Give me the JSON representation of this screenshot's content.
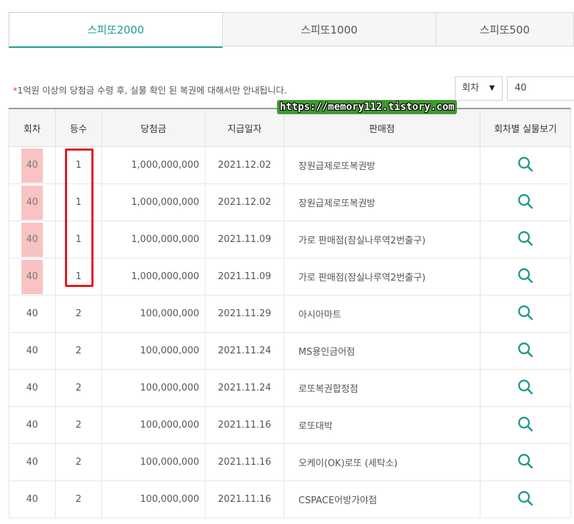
{
  "tabs": [
    {
      "label": "스피또2000",
      "active": true
    },
    {
      "label": "스피또1000",
      "active": false
    },
    {
      "label": "스피또500",
      "active": false
    }
  ],
  "notice": {
    "star": "*",
    "text": "1억원 이상의 당첨금 수령 후, 실물 확인 된 복권에 대해서만 안내됩니다."
  },
  "search": {
    "select_label": "회차",
    "round_value": "40"
  },
  "watermark": "https://memory112.tistory.com",
  "table": {
    "headers": [
      "회차",
      "등수",
      "당첨금",
      "지급일자",
      "판매점",
      "회차별 실물보기"
    ],
    "rows": [
      {
        "round": "40",
        "rank": "1",
        "prize": "1,000,000,000",
        "date": "2021.12.02",
        "store": "장원급제로또복권방",
        "highlight": true
      },
      {
        "round": "40",
        "rank": "1",
        "prize": "1,000,000,000",
        "date": "2021.12.02",
        "store": "장원급제로또복권방",
        "highlight": true
      },
      {
        "round": "40",
        "rank": "1",
        "prize": "1,000,000,000",
        "date": "2021.11.09",
        "store": "가로 판매점(잠실나루역2번출구)",
        "highlight": true
      },
      {
        "round": "40",
        "rank": "1",
        "prize": "1,000,000,000",
        "date": "2021.11.09",
        "store": "가로 판매점(잠실나루역2번출구)",
        "highlight": true
      },
      {
        "round": "40",
        "rank": "2",
        "prize": "100,000,000",
        "date": "2021.11.29",
        "store": "아시아마트",
        "highlight": false
      },
      {
        "round": "40",
        "rank": "2",
        "prize": "100,000,000",
        "date": "2021.11.24",
        "store": "MS용인금어점",
        "highlight": false
      },
      {
        "round": "40",
        "rank": "2",
        "prize": "100,000,000",
        "date": "2021.11.24",
        "store": "로또복권합정점",
        "highlight": false
      },
      {
        "round": "40",
        "rank": "2",
        "prize": "100,000,000",
        "date": "2021.11.16",
        "store": "로또대박",
        "highlight": false
      },
      {
        "round": "40",
        "rank": "2",
        "prize": "100,000,000",
        "date": "2021.11.16",
        "store": "오케이(OK)로또 (세탁소)",
        "highlight": false
      },
      {
        "round": "40",
        "rank": "2",
        "prize": "100,000,000",
        "date": "2021.11.16",
        "store": "CSPACE어방가야점",
        "highlight": false
      }
    ]
  },
  "icons": {
    "view": "search-icon"
  },
  "colors": {
    "accent": "#1f9a8a",
    "highlight": "#f8c3c3",
    "annotation": "#e1191d"
  }
}
